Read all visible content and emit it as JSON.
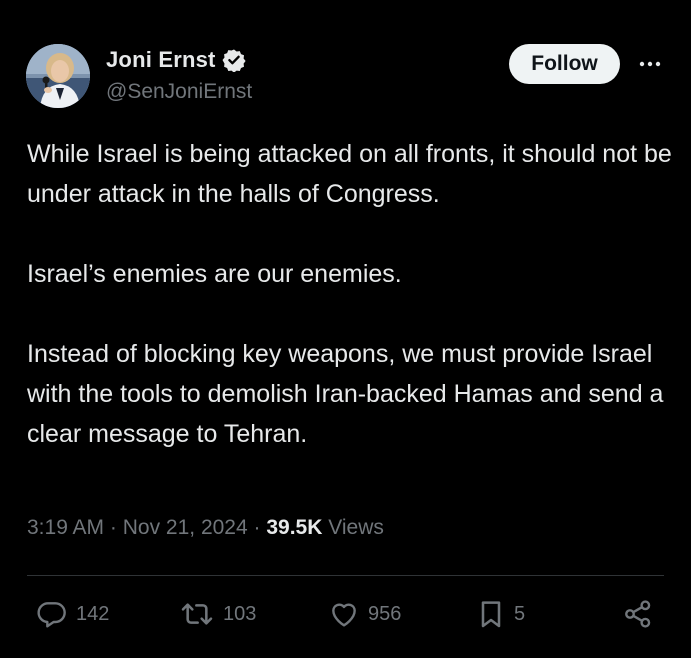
{
  "tweet": {
    "author": {
      "display_name": "Joni Ernst",
      "handle": "@SenJoniErnst",
      "verified_icon": "verified-badge-icon",
      "verified_color": "#1d9bf0"
    },
    "follow_label": "Follow",
    "more_icon": "more-horizontal-icon",
    "paragraphs": [
      "While Israel is being attacked on all fronts, it should not be under attack in the halls of Congress.",
      "Israel’s enemies are our enemies.",
      "Instead of blocking key weapons, we must provide Israel with the tools to demolish Iran-backed Hamas and send a clear message to Tehran."
    ],
    "meta": {
      "time": "3:19 AM",
      "date": "Nov 21, 2024",
      "separator": "·",
      "views_count": "39.5K",
      "views_label": "Views"
    },
    "actions": {
      "replies": "142",
      "reposts": "103",
      "likes": "956",
      "bookmarks": "5"
    }
  }
}
